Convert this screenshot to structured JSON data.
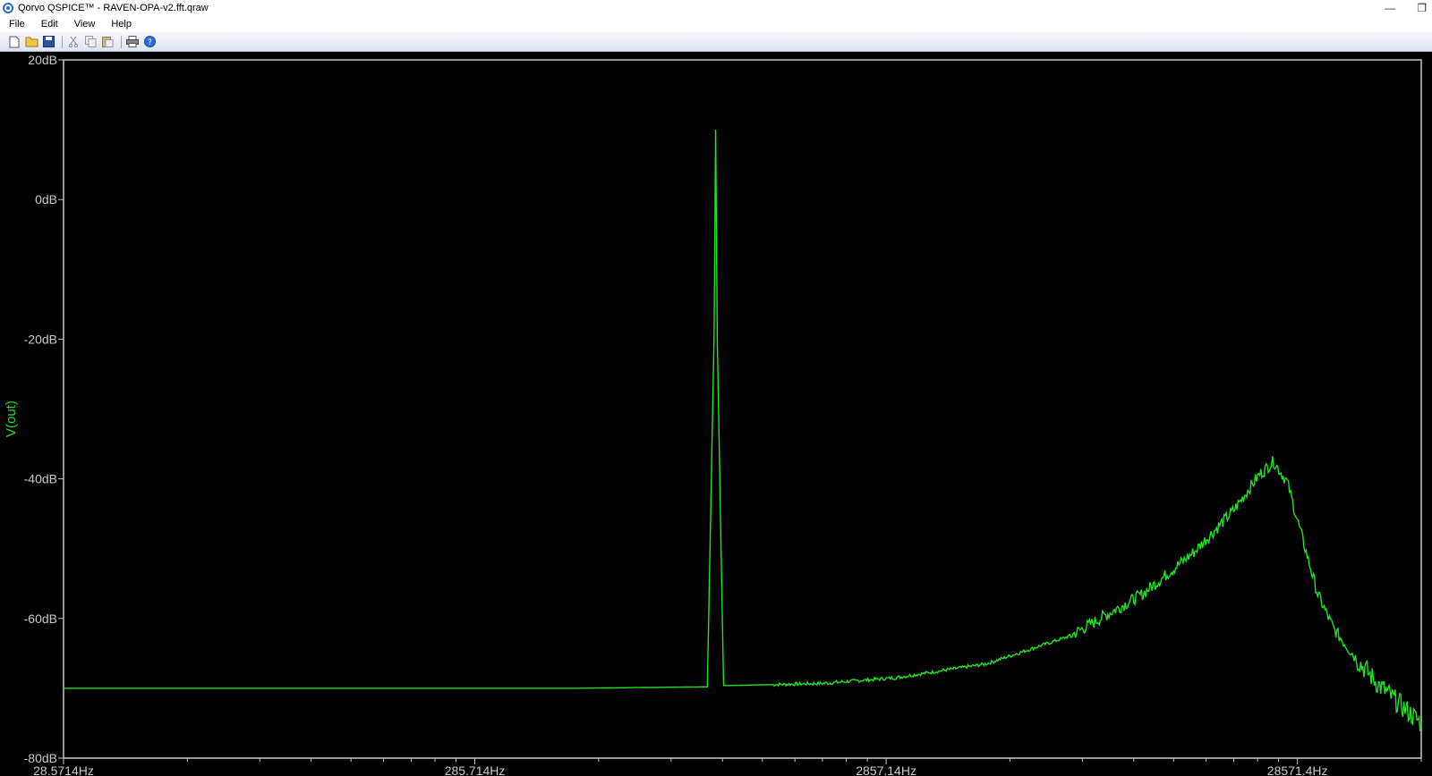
{
  "window": {
    "title": "Qorvo QSPICE™ - RAVEN-OPA-v2.fft.qraw",
    "minimize_glyph": "—",
    "restore_glyph": "❐"
  },
  "menu": {
    "items": [
      "File",
      "Edit",
      "View",
      "Help"
    ]
  },
  "toolbar": {
    "icons": [
      "new-file-icon",
      "open-folder-icon",
      "save-icon",
      "cut-icon",
      "copy-icon",
      "paste-icon",
      "print-icon",
      "help-icon"
    ]
  },
  "colors": {
    "trace": "#22e022",
    "axis": "#c8c8c8",
    "background": "#000000"
  },
  "chart_data": {
    "type": "line",
    "xscale": "log",
    "yscale": "linear",
    "xlim": [
      28.5714,
      57142.8
    ],
    "ylim": [
      -80,
      20
    ],
    "x_ticks": [
      28.5714,
      285.714,
      2857.14,
      28571.4
    ],
    "x_tick_labels": [
      "28.5714Hz",
      "285.714Hz",
      "2857.14Hz",
      "28571.4Hz"
    ],
    "y_ticks": [
      20,
      0,
      -20,
      -40,
      -60,
      -80
    ],
    "y_tick_labels": [
      "20dB",
      "0dB",
      "-20dB",
      "-40dB",
      "-60dB",
      "-80dB"
    ],
    "ylabel": "V(out)",
    "series": [
      {
        "name": "V(out)",
        "x": [
          28.5714,
          100,
          500,
          1000,
          1050,
          1090,
          1100,
          1110,
          1150,
          1200,
          2000,
          3000,
          5000,
          8000,
          12000,
          16000,
          20000,
          23000,
          25000,
          27000,
          28000,
          30000,
          32000,
          35000,
          40000,
          45000,
          50000,
          57142.8
        ],
        "y": [
          -70,
          -70,
          -70,
          -69.8,
          -69.8,
          -20,
          10,
          -20,
          -69.6,
          -69.6,
          -69.3,
          -68.5,
          -66.5,
          -62.5,
          -56.5,
          -50.5,
          -44.5,
          -39.5,
          -37.5,
          -40.5,
          -44,
          -50.5,
          -56.5,
          -61.5,
          -66,
          -69.5,
          -72,
          -75
        ]
      }
    ]
  }
}
